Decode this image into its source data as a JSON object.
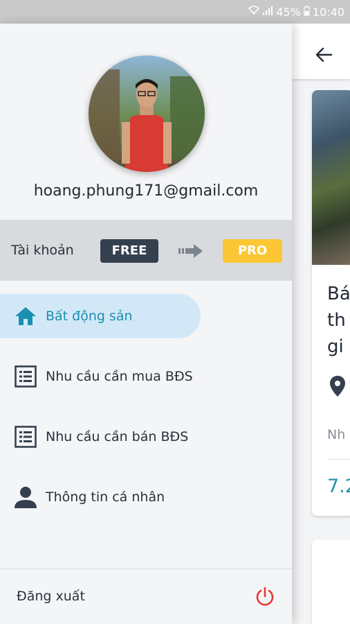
{
  "status_bar": {
    "battery": "45%",
    "time": "10:40",
    "icons": [
      "wifi-icon",
      "signal-icon",
      "battery-icon"
    ]
  },
  "drawer": {
    "email": "hoang.phung171@gmail.com",
    "account": {
      "label": "Tài khoản",
      "current_plan": "FREE",
      "upgrade_plan": "PRO",
      "free_color": "#35404f",
      "pro_color": "#fcc634"
    },
    "menu": [
      {
        "label": "Bất động sản",
        "icon": "home-icon",
        "active": true
      },
      {
        "label": "Nhu cầu cần mua BĐS",
        "icon": "list-icon",
        "active": false
      },
      {
        "label": "Nhu cầu cần bán BĐS",
        "icon": "list-icon",
        "active": false
      },
      {
        "label": "Thông tin cá nhân",
        "icon": "person-icon",
        "active": false
      }
    ],
    "logout_label": "Đăng xuất"
  },
  "background": {
    "card_title_partial": "Bá\nth\ngi",
    "card_subtitle_partial": "Nh",
    "card_price_partial": "7.2"
  },
  "colors": {
    "accent": "#1b8fb0",
    "active_bg": "#d3e8f7",
    "logout_red": "#e53935",
    "price_teal": "#2196a6"
  }
}
